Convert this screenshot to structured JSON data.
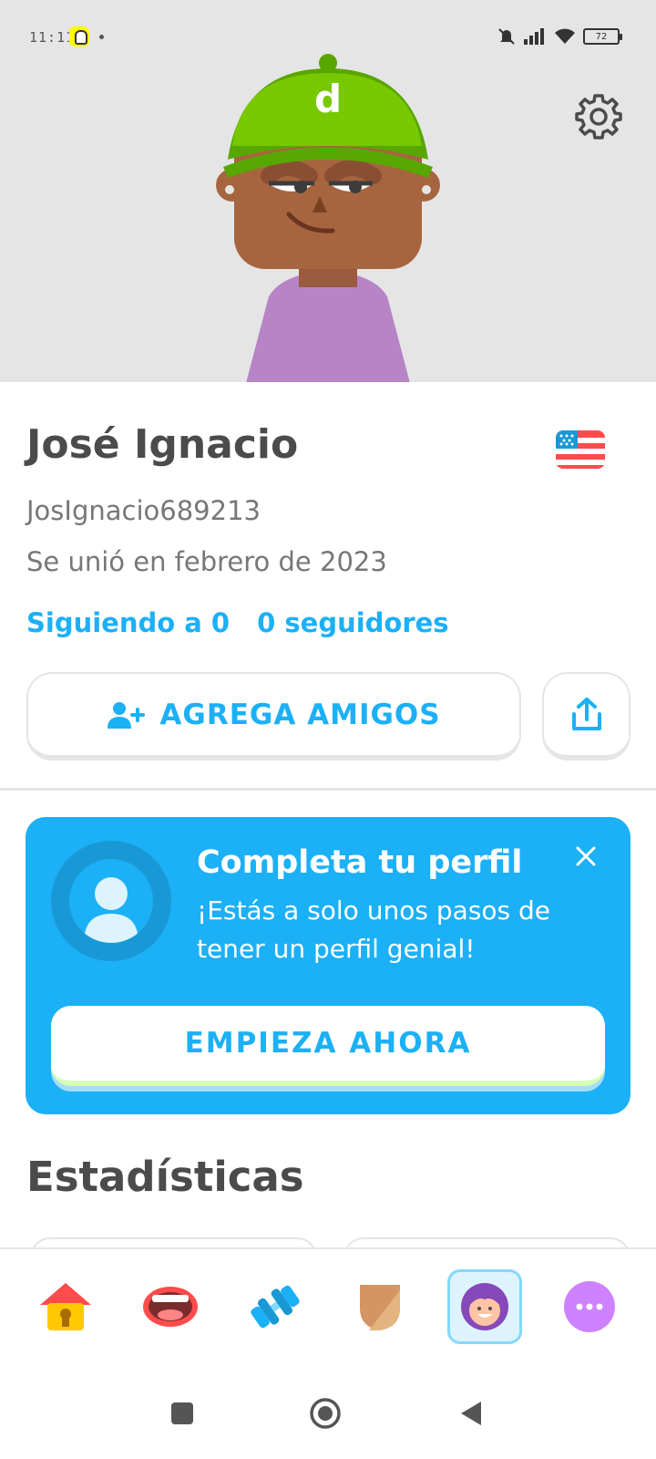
{
  "status_bar": {
    "time": "11:11",
    "battery": "72"
  },
  "profile": {
    "name": "José Ignacio",
    "username": "JosIgnacio689213",
    "joined": "Se unió en febrero de 2023",
    "following": "Siguiendo a 0",
    "followers": "0 seguidores",
    "flag": "us-flag-icon"
  },
  "actions": {
    "add_friends_label": "AGREGA AMIGOS",
    "share": "share-icon"
  },
  "promo": {
    "title": "Completa tu perfil",
    "text": "¡Estás a solo unos pasos de tener un perfil genial!",
    "cta_label": "EMPIEZA AHORA"
  },
  "stats": {
    "title": "Estadísticas"
  },
  "bottom_nav": {
    "items": [
      "home-icon",
      "speak-icon",
      "practice-icon",
      "leagues-icon",
      "profile-icon",
      "more-icon"
    ],
    "active": "profile-icon"
  },
  "colors": {
    "accent": "#1cb0f6",
    "header_bg": "#e5e5e5",
    "text": "#4b4b4b",
    "muted": "#777777"
  }
}
